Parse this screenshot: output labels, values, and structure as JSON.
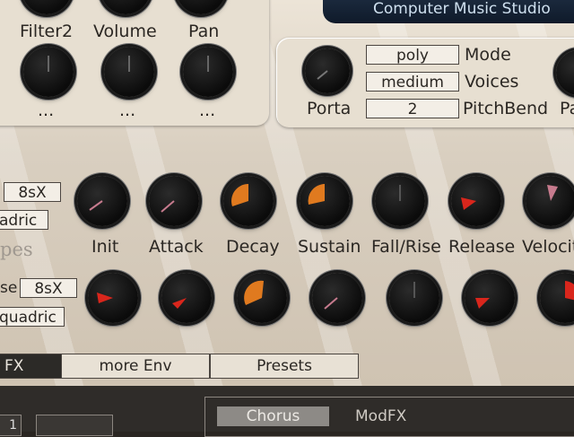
{
  "header": {
    "brand": "Computer Music Studio"
  },
  "top_knobs": {
    "row1_labels": [
      "Filter2",
      "Volume",
      "Pan"
    ],
    "row2_labels": [
      "...",
      "...",
      "..."
    ]
  },
  "voice_section": {
    "porta_label": "Porta",
    "partial_label": "Pa",
    "mode_value": "poly",
    "mode_label": "Mode",
    "voices_value": "medium",
    "voices_label": "Voices",
    "pitchbend_value": "2",
    "pitchbend_label": "PitchBend"
  },
  "envelope": {
    "row1_field": "8sX",
    "row1_curve": "adric",
    "row2_prefix": "se",
    "row2_field": "8sX",
    "row2_curve": "quadric",
    "faded_label": "pes",
    "labels": [
      "Init",
      "Attack",
      "Decay",
      "Sustain",
      "Fall/Rise",
      "Release",
      "Velocit"
    ]
  },
  "tabs": [
    {
      "label": "FX",
      "active": true
    },
    {
      "label": "more Env",
      "active": false
    },
    {
      "label": "Presets",
      "active": false
    }
  ],
  "bottom": {
    "left_text": "1",
    "chorus_label": "Chorus",
    "modfx_label": "ModFX"
  },
  "colors": {
    "accent_orange": "#e07a1f",
    "accent_red": "#d9261c",
    "pink_tick": "#c77b8e"
  }
}
